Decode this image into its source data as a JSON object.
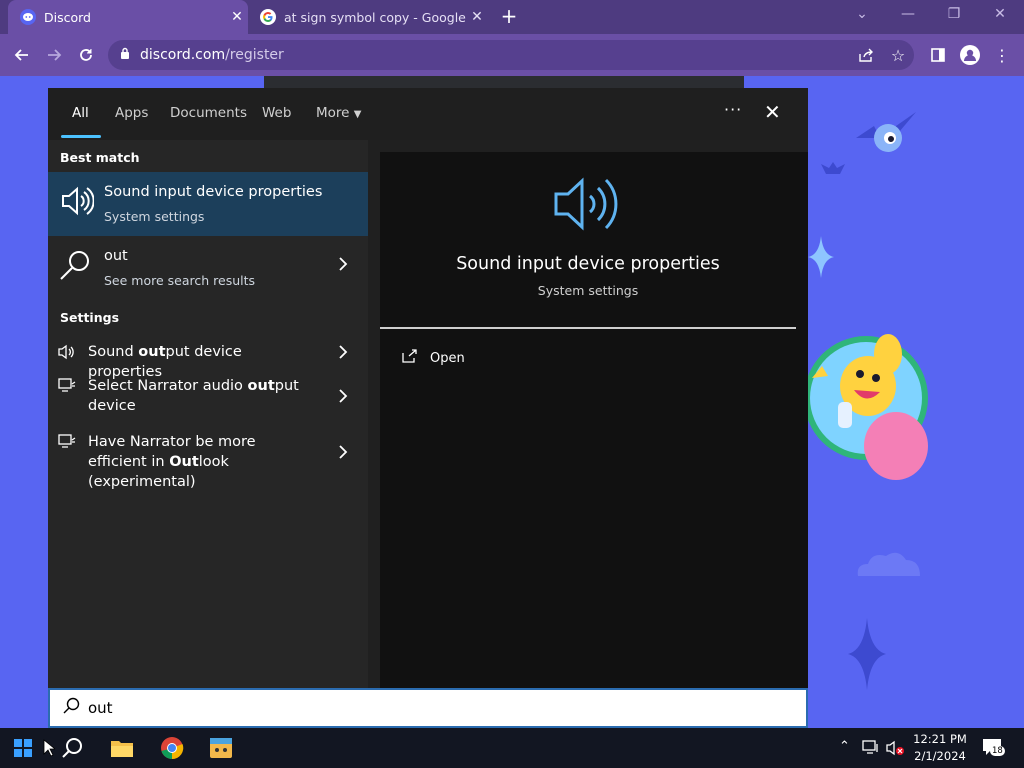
{
  "browser": {
    "tabs": [
      {
        "title": "Discord",
        "active": true
      },
      {
        "title": "at sign symbol copy - Google Se",
        "active": false
      }
    ],
    "address": {
      "host": "discord.com",
      "path": "/register"
    }
  },
  "search": {
    "tabs": [
      "All",
      "Apps",
      "Documents",
      "Web",
      "More"
    ],
    "best_match_heading": "Best match",
    "best_match": {
      "title": "Sound input device properties",
      "subtitle": "System settings"
    },
    "web_result": {
      "title": "out",
      "subtitle": "See more search results"
    },
    "settings_heading": "Settings",
    "settings_results": [
      {
        "pre": "Sound ",
        "bold": "out",
        "post": "put device properties"
      },
      {
        "pre": "Select Narrator audio ",
        "bold": "out",
        "post": "put device"
      },
      {
        "pre": "Have Narrator be more efficient in ",
        "bold": "Out",
        "post": "look (experimental)"
      }
    ],
    "preview": {
      "title": "Sound input device properties",
      "subtitle": "System settings",
      "action": "Open"
    },
    "query": "out",
    "accent_color": "#4cc2ff"
  },
  "taskbar": {
    "time": "12:21 PM",
    "date": "2/1/2024",
    "notification_count": "18",
    "apps": [
      "start-icon",
      "search-icon",
      "file-explorer-icon",
      "chrome-icon",
      "app-icon"
    ]
  }
}
